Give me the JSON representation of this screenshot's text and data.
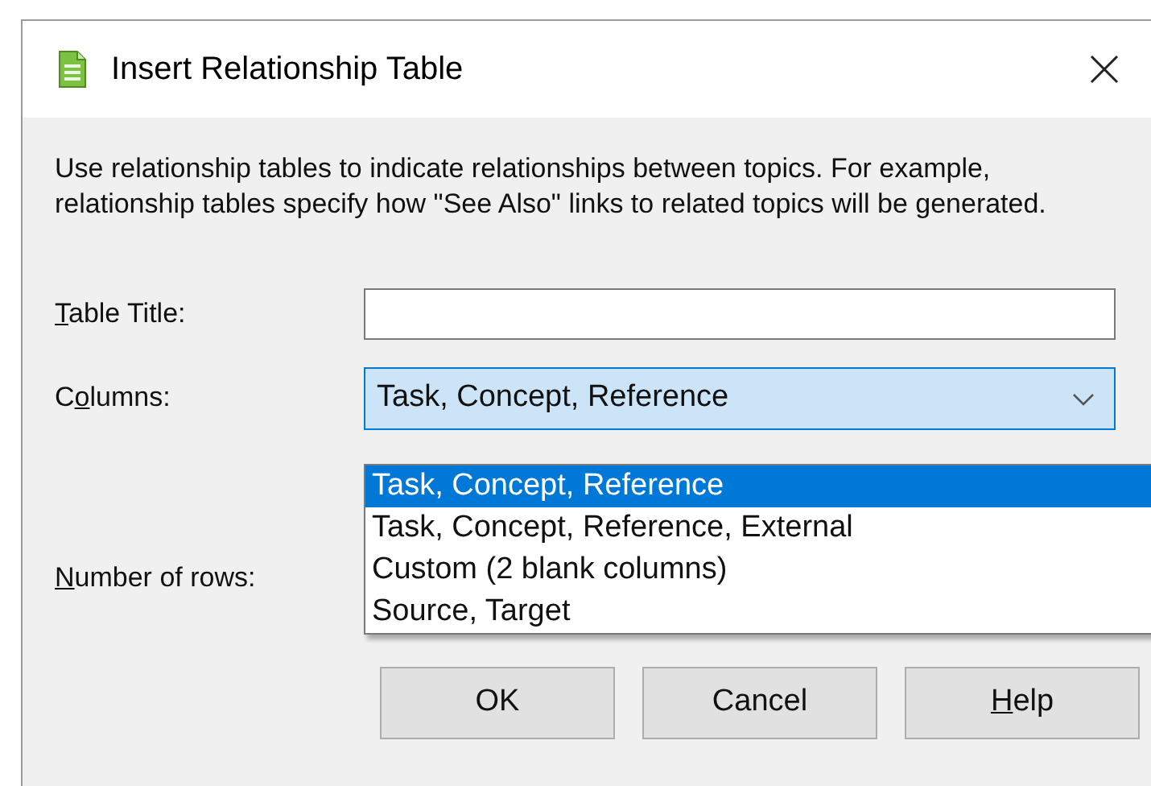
{
  "window": {
    "title": "Insert Relationship Table"
  },
  "description": "Use relationship tables to indicate relationships between topics. For example, relationship tables specify how \"See Also\" links to related topics will be generated.",
  "table_title": {
    "label": {
      "key": "T",
      "after": "able Title:"
    }
  },
  "columns": {
    "label": {
      "before": "C",
      "key": "o",
      "after": "lumns:"
    },
    "value": "Task, Concept, Reference",
    "expanded": true,
    "options": [
      {
        "label": "Task, Concept, Reference",
        "selected": true
      },
      {
        "label": "Task, Concept, Reference, External",
        "selected": false
      },
      {
        "label": "Custom (2 blank columns)",
        "selected": false
      },
      {
        "label": "Source, Target",
        "selected": false
      }
    ]
  },
  "rows": {
    "label": {
      "key": "N",
      "after": "umber of rows:"
    }
  },
  "buttons": [
    {
      "before": "OK"
    },
    {
      "before": "Cancel"
    },
    {
      "key": "H",
      "after": "elp"
    }
  ]
}
